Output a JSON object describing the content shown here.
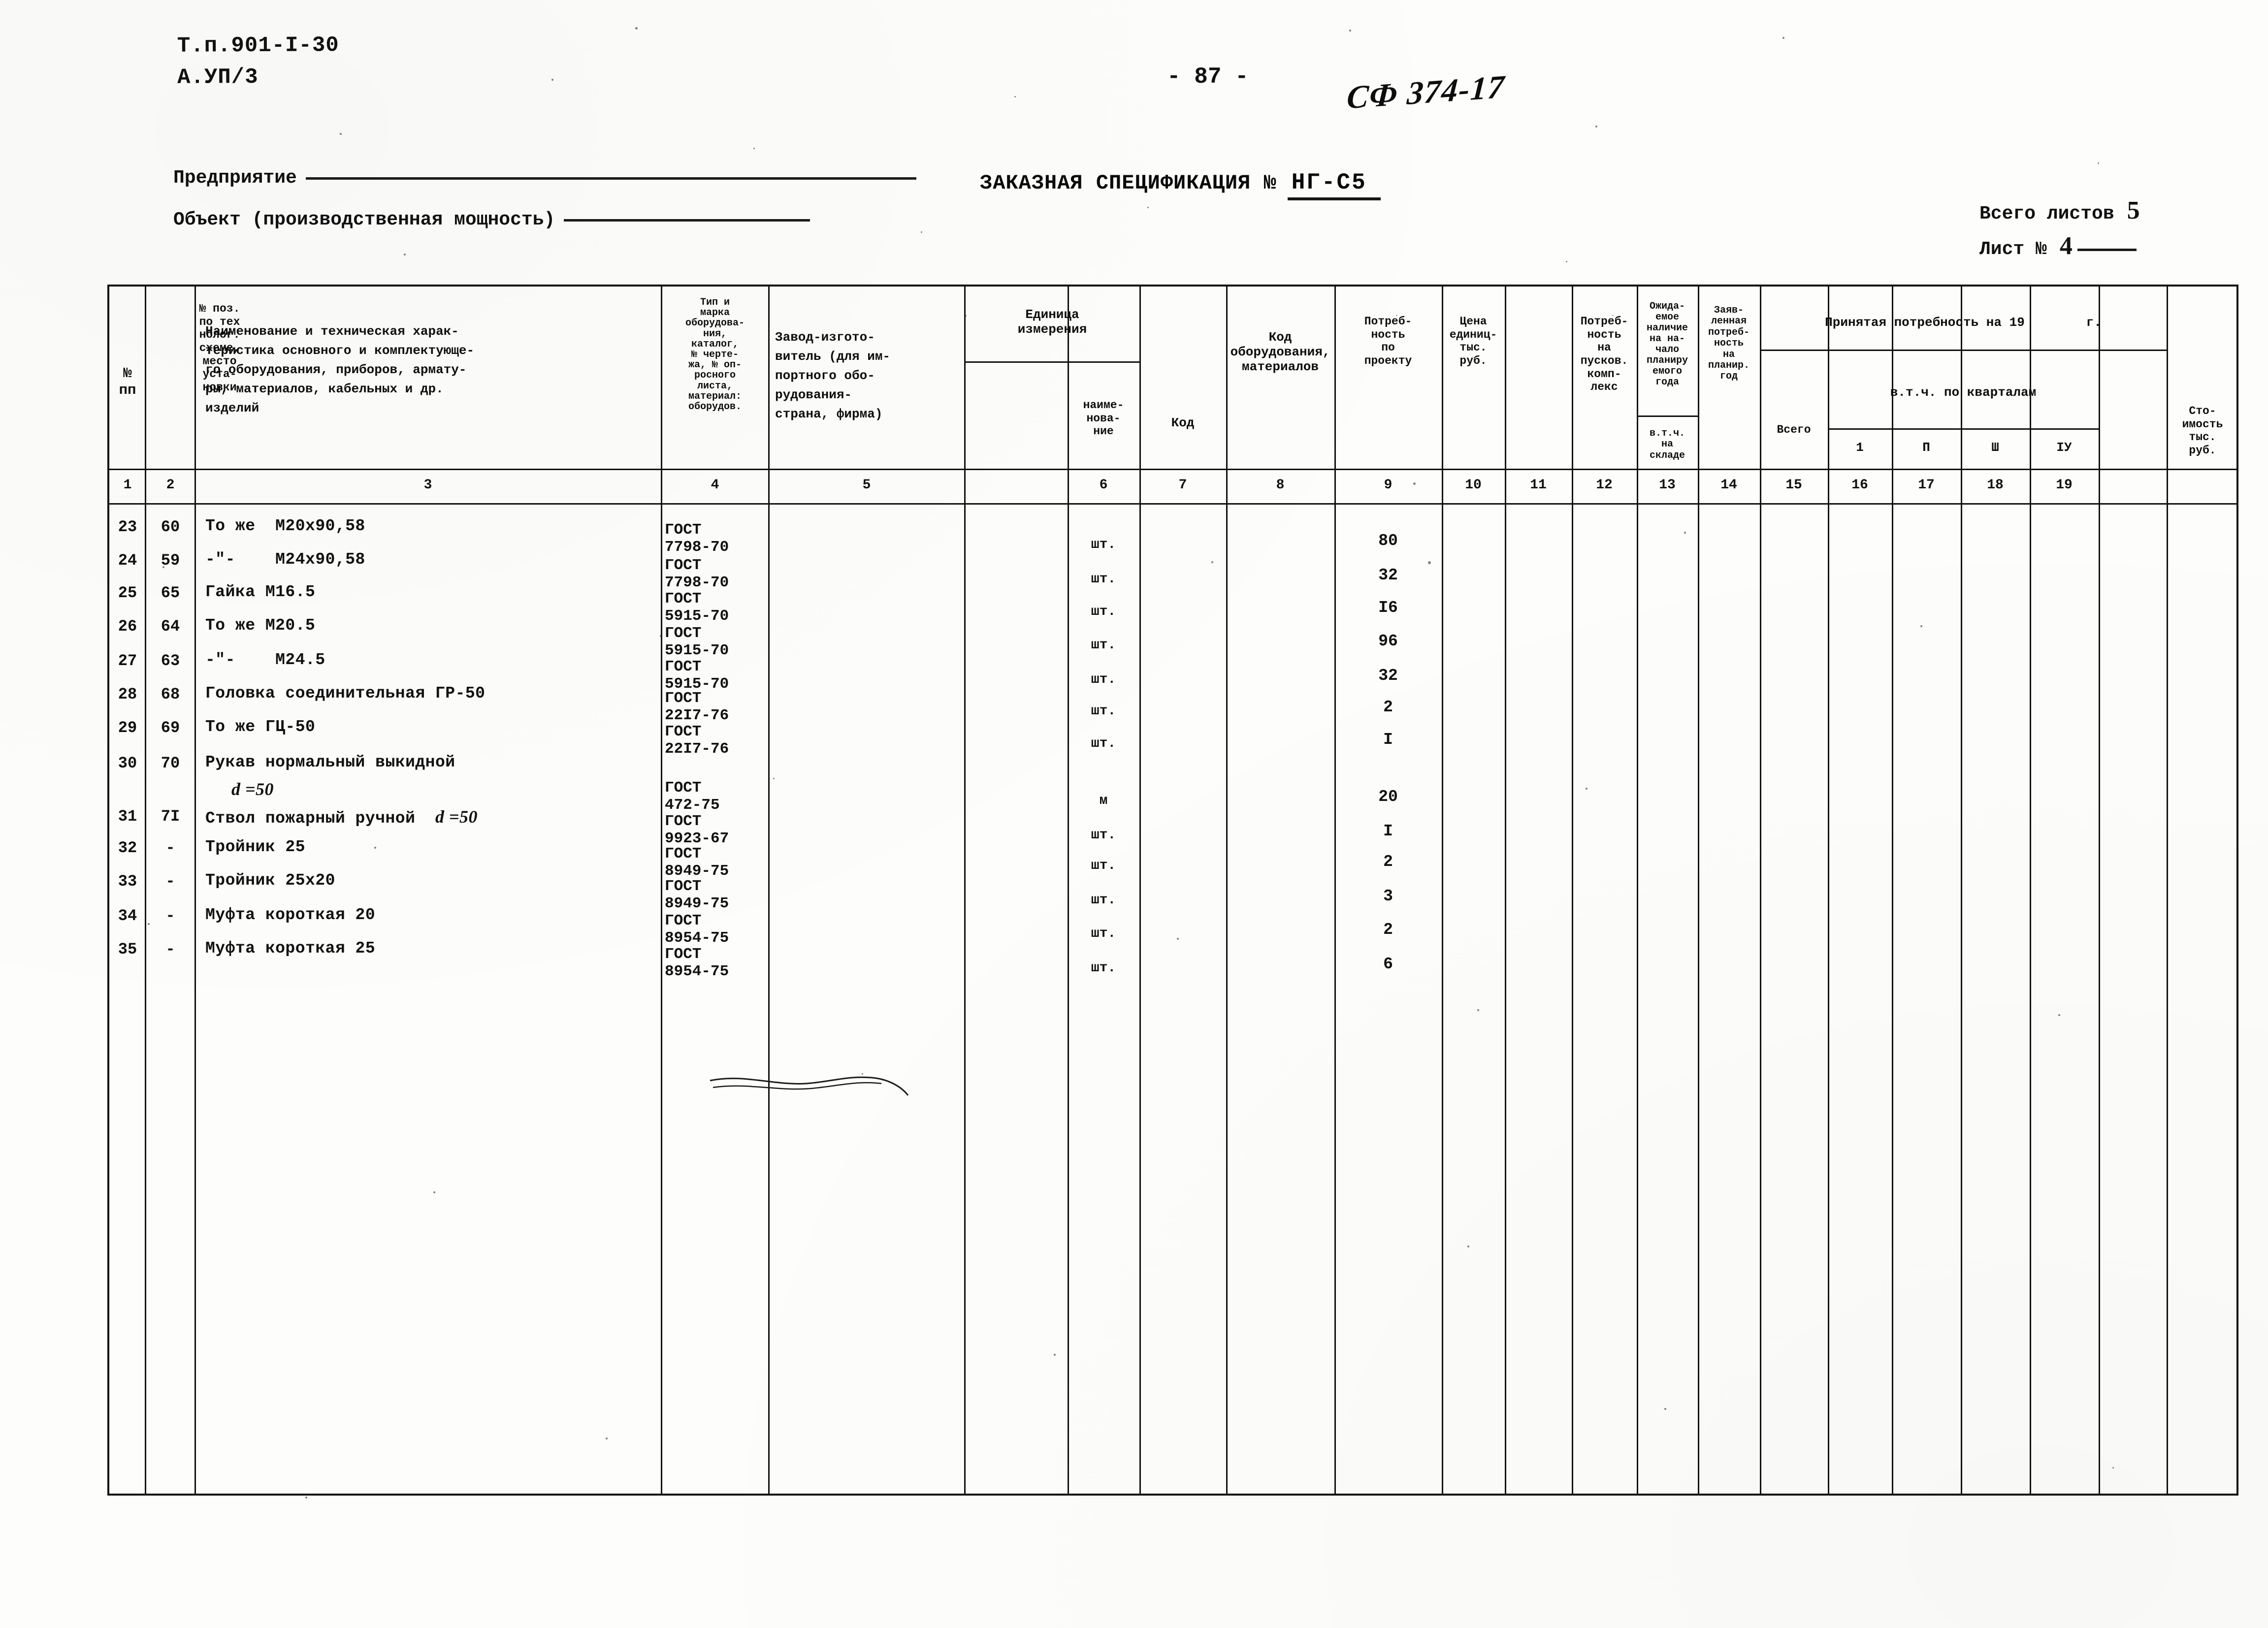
{
  "header": {
    "project_code_line1": "Т.п.901-I-30",
    "project_code_line2": "А.УП/3",
    "page_number": "- 87 -",
    "hand_reference": "СФ 374-17",
    "enterprise_label": "Предприятие",
    "object_label": "Объект (производственная мощность)",
    "title": "ЗАКАЗНАЯ СПЕЦИФИКАЦИЯ №",
    "spec_number": "НГ-С5",
    "total_sheets_label": "Всего листов",
    "total_sheets_value": "5",
    "sheet_label": "Лист №",
    "sheet_value": "4"
  },
  "table": {
    "columns": [
      {
        "num": "1",
        "title": "№\nпп"
      },
      {
        "num": "2",
        "title": "№ поз.\nпо тех\nнолог.\nсхеме,\nместо\nуста-\nновки"
      },
      {
        "num": "3",
        "title": "Наименование и техническая харак-\nтеристика основного и комплектующе-\nго оборудования, приборов, армату-\nры, материалов, кабельных и др.\nизделий"
      },
      {
        "num": "4",
        "title": "Тип и\nмарка\nоборудова-\nния,\nкаталог,\n№ черте-\nжа, № оп-\nросного\nлиста,\nматериал:\nоборудов."
      },
      {
        "num": "5",
        "title": "Завод-изгото-\nвитель (для им-\nпортного обо-\nрудования-\nстрана, фирма)"
      },
      {
        "num": "6",
        "title": "наиме-\nнова-\nние",
        "group": "Единица\nизмерения"
      },
      {
        "num": "7",
        "title": "Код",
        "group": "Единица\nизмерения"
      },
      {
        "num": "8",
        "title": "Код оборудования,\nматериалов"
      },
      {
        "num": "9",
        "title": "Потре́б-\nность\nпо\nпроекту"
      },
      {
        "num": "10",
        "title": "Цена\nединиц-\nтыс.\nруб."
      },
      {
        "num": "11",
        "title": "Потре́б-\nность\nна\nпусков.\nкомп-\nлекс"
      },
      {
        "num": "12",
        "title": "Ожида-\nемое\nналичие\nна на-\nчало\nпланиру\nемого\nгода",
        "sub": "в.т.ч.\nна\nскладе"
      },
      {
        "num": "13",
        "title": "Заяв-\nленная\nпотреб-\nность\nна\nпланир.\nгод"
      },
      {
        "num": "14",
        "title": "Всего",
        "group": "Принятая потребность на 19        г."
      },
      {
        "num": "15",
        "title": "1",
        "group": "в.т.ч. по кварталам"
      },
      {
        "num": "16",
        "title": "П",
        "group": "в.т.ч. по кварталам"
      },
      {
        "num": "17",
        "title": "Ш",
        "group": "в.т.ч. по кварталам"
      },
      {
        "num": "18",
        "title": "IУ",
        "group": "в.т.ч. по кварталам"
      },
      {
        "num": "19",
        "title": "Сто-\nимость\nтыс.\nруб."
      }
    ],
    "group_headers": {
      "unit_of_measure": "Единица\nизмерения",
      "accepted_demand": "Принятая потребность на 19        г.",
      "by_quarters": "в.т.ч. по кварталам",
      "expected_stock": "Ожида-\nемое\nналичие\nна на-\nчало\nпланиру\nемого\nгода",
      "expected_stock_sub": "в.т.ч.\nна\nскладе"
    },
    "rows": [
      {
        "n": "23",
        "pos": "60",
        "name": "То же  М20х90,58",
        "gost": "ГОСТ\n7798-70",
        "unit": "шт.",
        "qty": "80"
      },
      {
        "n": "24",
        "pos": "59",
        "name": "-\"-    М24х90,58",
        "gost": "ГОСТ\n7798-70",
        "unit": "шт.",
        "qty": "32"
      },
      {
        "n": "25",
        "pos": "65",
        "name": "Гайка М16.5",
        "gost": "ГОСТ\n5915-70",
        "unit": "шт.",
        "qty": "I6"
      },
      {
        "n": "26",
        "pos": "64",
        "name": "То же М20.5",
        "gost": "ГОСТ\n5915-70",
        "unit": "шт.",
        "qty": "96"
      },
      {
        "n": "27",
        "pos": "63",
        "name": "-\"-    М24.5",
        "gost": "ГОСТ\n5915-70",
        "unit": "шт.",
        "qty": "32"
      },
      {
        "n": "28",
        "pos": "68",
        "name": "Головка соединительная ГР-50",
        "gost": "ГОСТ\n22I7-76",
        "unit": "шт.",
        "qty": "2"
      },
      {
        "n": "29",
        "pos": "69",
        "name": "То же ГЦ-50",
        "gost": "ГОСТ\n22I7-76",
        "unit": "шт.",
        "qty": "I"
      },
      {
        "n": "30",
        "pos": "70",
        "name": "Рукав нормальный выкидной",
        "name2": "d =50",
        "gost": "ГОСТ\n472-75",
        "unit": "м",
        "qty": "20"
      },
      {
        "n": "31",
        "pos": "7I",
        "name": "Ствол пожарный ручной",
        "name_tail": "d =50",
        "gost": "ГОСТ\n9923-67",
        "unit": "шт.",
        "qty": "I"
      },
      {
        "n": "32",
        "pos": "-",
        "name": "Тройник 25",
        "gost": "ГОСТ\n8949-75",
        "unit": "шт.",
        "qty": "2"
      },
      {
        "n": "33",
        "pos": "-",
        "name": "Тройник 25х20",
        "gost": "ГОСТ\n8949-75",
        "unit": "шт.",
        "qty": "3"
      },
      {
        "n": "34",
        "pos": "-",
        "name": "Муфта короткая 20",
        "gost": "ГОСТ\n8954-75",
        "unit": "шт.",
        "qty": "2"
      },
      {
        "n": "35",
        "pos": "-",
        "name": "Муфта короткая 25",
        "gost": "ГОСТ\n8954-75",
        "unit": "шт.",
        "qty": "6"
      }
    ]
  }
}
